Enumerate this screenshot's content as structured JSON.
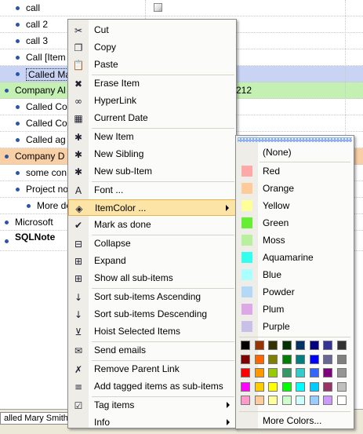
{
  "tree": {
    "rows": [
      {
        "label": "call",
        "indent": 1
      },
      {
        "label": "call 2",
        "indent": 1
      },
      {
        "label": "call 3",
        "indent": 1
      },
      {
        "label": "Call [Item",
        "indent": 1
      },
      {
        "label": "Called Ma",
        "indent": 1,
        "highlight": "blue",
        "selected": true
      },
      {
        "label": "Company Al",
        "indent": 0,
        "highlight": "green",
        "extra": "212"
      },
      {
        "label": "Called Co",
        "indent": 1
      },
      {
        "label": "Called Co",
        "indent": 1
      },
      {
        "label": "Called ag",
        "indent": 1
      },
      {
        "label": "Company D",
        "indent": 0,
        "highlight": "orange"
      },
      {
        "label": "some con",
        "indent": 1
      },
      {
        "label": "Project no",
        "indent": 1
      },
      {
        "label": "More de",
        "indent": 2
      },
      {
        "label": "Microsoft",
        "indent": 0
      },
      {
        "label": "SQLNote",
        "indent": 0,
        "bold": true
      }
    ]
  },
  "statusbar": {
    "text": "alled Mary Smith »"
  },
  "context_menu": {
    "items": [
      {
        "label": "Cut",
        "icon": "scissors-icon",
        "glyph": "✂"
      },
      {
        "label": "Copy",
        "icon": "copy-icon",
        "glyph": "❐"
      },
      {
        "label": "Paste",
        "icon": "paste-icon",
        "glyph": "📋"
      },
      {
        "label": "Erase Item",
        "icon": "erase-icon",
        "glyph": "✖",
        "sep_before": true
      },
      {
        "label": "HyperLink",
        "icon": "link-icon",
        "glyph": "∞"
      },
      {
        "label": "Current Date",
        "icon": "calendar-icon",
        "glyph": "▦"
      },
      {
        "label": "New Item",
        "icon": "new-item-icon",
        "glyph": "✱",
        "sep_before": true
      },
      {
        "label": "New Sibling",
        "icon": "new-sibling-icon",
        "glyph": "✱"
      },
      {
        "label": "New sub-Item",
        "icon": "new-subitem-icon",
        "glyph": "✱"
      },
      {
        "label": "Font ...",
        "icon": "font-icon",
        "glyph": "A",
        "sep_before": true
      },
      {
        "label": "ItemColor ...",
        "icon": "paint-bucket-icon",
        "glyph": "◈",
        "submenu": true,
        "hot": true
      },
      {
        "label": "Mark as done",
        "icon": "checkmark-icon",
        "glyph": "✔"
      },
      {
        "label": "Collapse",
        "icon": "collapse-icon",
        "glyph": "⊟",
        "sep_before": true
      },
      {
        "label": "Expand",
        "icon": "expand-icon",
        "glyph": "⊞"
      },
      {
        "label": "Show all sub-items",
        "icon": "show-all-icon",
        "glyph": "⊞"
      },
      {
        "label": "Sort sub-items Ascending",
        "icon": "sort-ascending-icon",
        "glyph": "↓",
        "sep_before": true
      },
      {
        "label": "Sort sub-items Descending",
        "icon": "sort-descending-icon",
        "glyph": "↓"
      },
      {
        "label": "Hoist Selected Items",
        "icon": "hoist-icon",
        "glyph": "⊻"
      },
      {
        "label": "Send emails",
        "icon": "email-icon",
        "glyph": "✉",
        "sep_before": true
      },
      {
        "label": "Remove Parent Link",
        "icon": "remove-link-icon",
        "glyph": "✗",
        "sep_before": true
      },
      {
        "label": "Add tagged items as sub-items",
        "icon": "add-tagged-icon",
        "glyph": "≡"
      },
      {
        "label": "Tag items",
        "icon": "tag-icon",
        "glyph": "☑",
        "submenu": true,
        "sep_before": true
      },
      {
        "label": "Info",
        "icon": "info-icon",
        "glyph": "",
        "submenu": true
      }
    ]
  },
  "color_menu": {
    "none_label": "(None)",
    "colors": [
      {
        "label": "Red",
        "swatch": "#ffa8a8"
      },
      {
        "label": "Orange",
        "swatch": "#ffcc99"
      },
      {
        "label": "Yellow",
        "swatch": "#ffff99"
      },
      {
        "label": "Green",
        "swatch": "#66ee33"
      },
      {
        "label": "Moss",
        "swatch": "#b8f0a0"
      },
      {
        "label": "Aquamarine",
        "swatch": "#33ffee"
      },
      {
        "label": "Blue",
        "swatch": "#aaffff"
      },
      {
        "label": "Powder",
        "swatch": "#b3d9f7"
      },
      {
        "label": "Plum",
        "swatch": "#dda8e8"
      },
      {
        "label": "Purple",
        "swatch": "#c8c0e8"
      }
    ],
    "palette": [
      [
        "#000000",
        "#993300",
        "#333300",
        "#003300",
        "#003366",
        "#000080",
        "#333399",
        "#333333"
      ],
      [
        "#800000",
        "#ff6600",
        "#808000",
        "#008000",
        "#008080",
        "#0000ff",
        "#666699",
        "#808080"
      ],
      [
        "#ff0000",
        "#ff9900",
        "#99cc00",
        "#339966",
        "#33cccc",
        "#3366ff",
        "#800080",
        "#969696"
      ],
      [
        "#ff00ff",
        "#ffcc00",
        "#ffff00",
        "#00ff00",
        "#00ffff",
        "#00ccff",
        "#993366",
        "#c0c0c0"
      ],
      [
        "#ff99cc",
        "#ffcc99",
        "#ffff99",
        "#ccffcc",
        "#ccffff",
        "#99ccff",
        "#cc99ff",
        "#ffffff"
      ]
    ],
    "more_label": "More Colors..."
  }
}
